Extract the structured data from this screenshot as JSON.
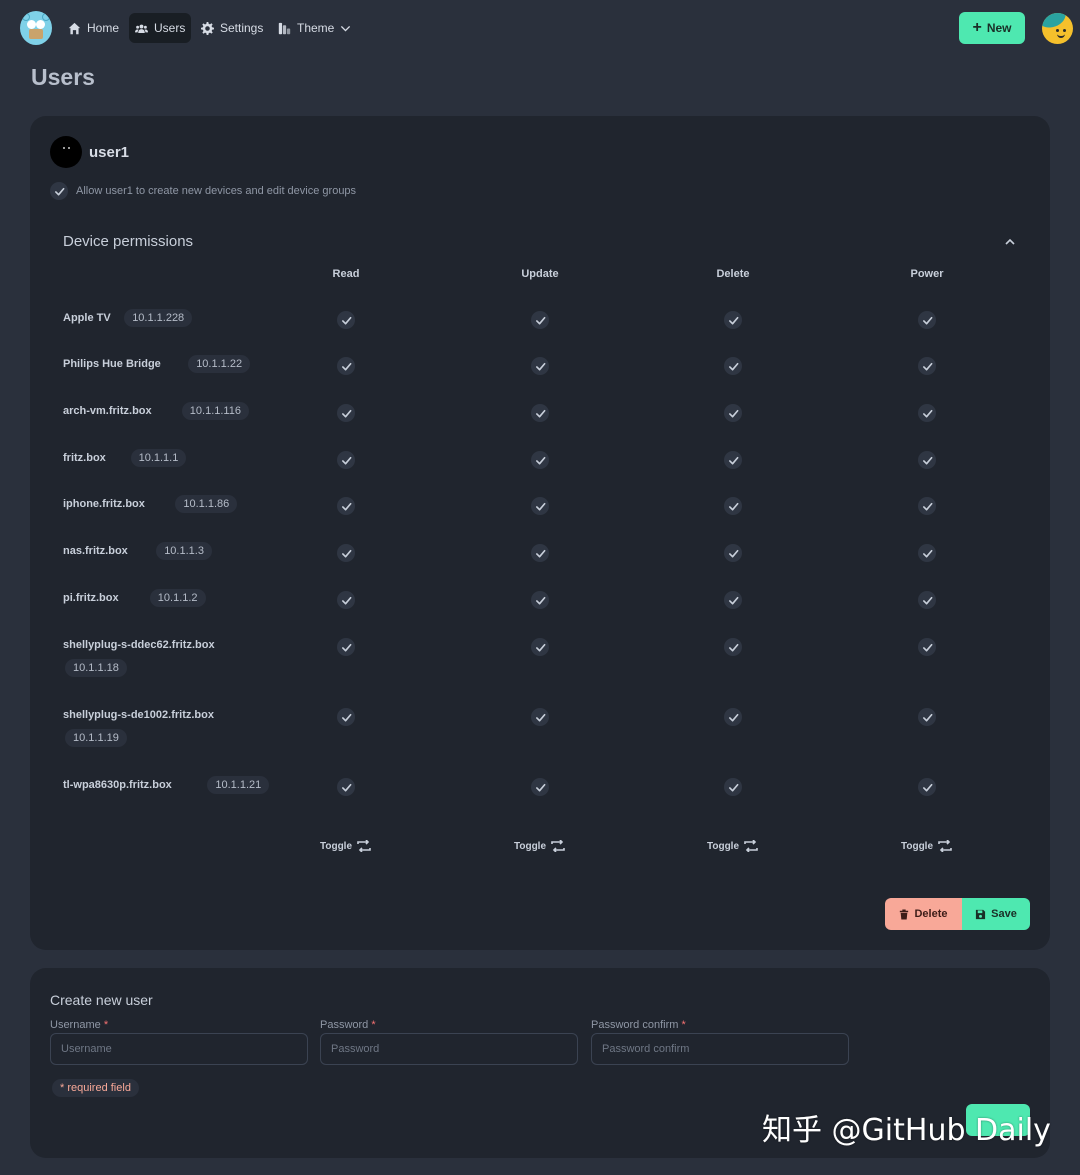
{
  "nav": {
    "items": [
      {
        "label": "Home",
        "icon": "home-icon"
      },
      {
        "label": "Users",
        "icon": "users-icon",
        "active": true
      },
      {
        "label": "Settings",
        "icon": "gear-icon"
      },
      {
        "label": "Theme",
        "icon": "palette-icon"
      }
    ],
    "new_label": "New"
  },
  "page": {
    "title": "Users"
  },
  "user_card": {
    "username": "user1",
    "allow_text": "Allow user1 to create new devices and edit device groups",
    "allow_checked": true,
    "permissions_title": "Device permissions",
    "columns": [
      "Read",
      "Update",
      "Delete",
      "Power"
    ],
    "devices": [
      {
        "name": "Apple TV",
        "ip": "10.1.1.228",
        "perms": [
          true,
          true,
          true,
          true
        ]
      },
      {
        "name": "Philips Hue Bridge",
        "ip": "10.1.1.22",
        "perms": [
          true,
          true,
          true,
          true
        ]
      },
      {
        "name": "arch-vm.fritz.box",
        "ip": "10.1.1.116",
        "perms": [
          true,
          true,
          true,
          true
        ]
      },
      {
        "name": "fritz.box",
        "ip": "10.1.1.1",
        "perms": [
          true,
          true,
          true,
          true
        ]
      },
      {
        "name": "iphone.fritz.box",
        "ip": "10.1.1.86",
        "perms": [
          true,
          true,
          true,
          true
        ]
      },
      {
        "name": "nas.fritz.box",
        "ip": "10.1.1.3",
        "perms": [
          true,
          true,
          true,
          true
        ]
      },
      {
        "name": "pi.fritz.box",
        "ip": "10.1.1.2",
        "perms": [
          true,
          true,
          true,
          true
        ]
      },
      {
        "name": "shellyplug-s-ddec62.fritz.box",
        "ip": "10.1.1.18",
        "perms": [
          true,
          true,
          true,
          true
        ]
      },
      {
        "name": "shellyplug-s-de1002.fritz.box",
        "ip": "10.1.1.19",
        "perms": [
          true,
          true,
          true,
          true
        ]
      },
      {
        "name": "tl-wpa8630p.fritz.box",
        "ip": "10.1.1.21",
        "perms": [
          true,
          true,
          true,
          true
        ]
      }
    ],
    "toggle_label": "Toggle",
    "delete_label": "Delete",
    "save_label": "Save"
  },
  "create_user": {
    "title": "Create new user",
    "fields": [
      {
        "label": "Username",
        "placeholder": "Username"
      },
      {
        "label": "Password",
        "placeholder": "Password"
      },
      {
        "label": "Password confirm",
        "placeholder": "Password confirm"
      }
    ],
    "required_mark": "*",
    "required_note": "* required field"
  },
  "watermark": "知乎 @GitHub Daily",
  "colors": {
    "accent": "#4ee8b0",
    "danger": "#f8a898",
    "background": "#2a303c",
    "card": "#20252e"
  }
}
